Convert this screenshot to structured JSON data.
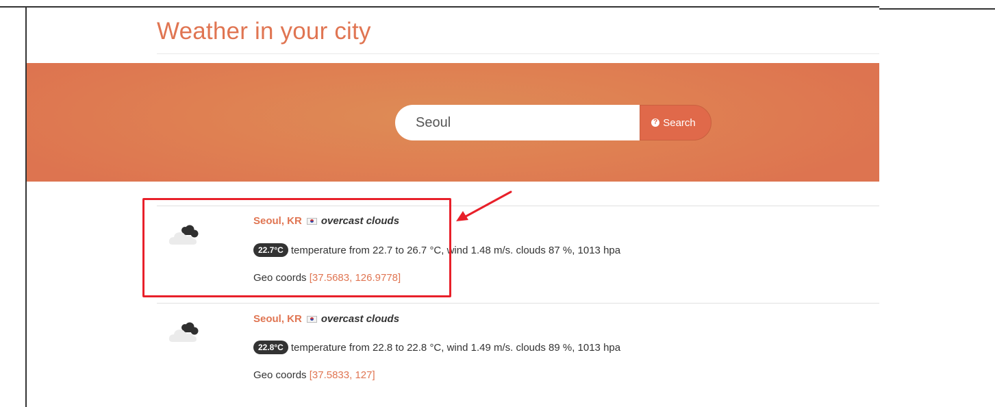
{
  "page": {
    "title": "Weather in your city"
  },
  "search": {
    "value": "Seoul",
    "button_label": "Search",
    "button_icon": "question-circle-icon"
  },
  "results": [
    {
      "city": "Seoul, KR",
      "flag": "kr-flag-icon",
      "conditions": "overcast clouds",
      "weather_icon": "overcast-cloud-icon",
      "temp_badge": "22.7°C",
      "details": "temperature from 22.7 to 26.7 °C, wind 1.48 m/s. clouds 87 %, 1013 hpa",
      "geo_label": "Geo coords",
      "geo_coords": "[37.5683, 126.9778]"
    },
    {
      "city": "Seoul, KR",
      "flag": "kr-flag-icon",
      "conditions": "overcast clouds",
      "weather_icon": "overcast-cloud-icon",
      "temp_badge": "22.8°C",
      "details": "temperature from 22.8 to 22.8 °C, wind 1.49 m/s. clouds 89 %, 1013 hpa",
      "geo_label": "Geo coords",
      "geo_coords": "[37.5833, 127]"
    }
  ],
  "colors": {
    "accent": "#e07552",
    "hero": "#de8556",
    "button": "#e0694a",
    "badge": "#333333",
    "annotation": "#e8202a"
  }
}
